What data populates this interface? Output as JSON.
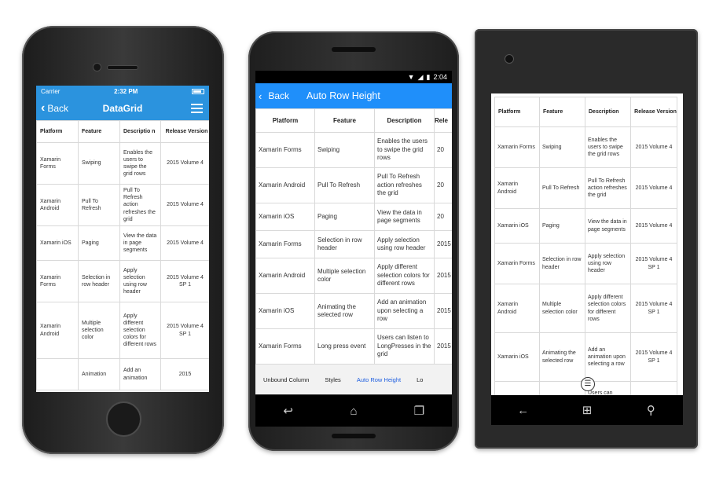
{
  "ios": {
    "status": {
      "carrier": "Carrier",
      "time": "2:32 PM"
    },
    "nav": {
      "back": "Back",
      "title": "DataGrid"
    },
    "columns": [
      "Platform",
      "Feature",
      "Descriptio n",
      "Release Version"
    ],
    "rows": [
      [
        "Xamarin Forms",
        "Swiping",
        "Enables the users to swipe the grid rows",
        "2015 Volume 4"
      ],
      [
        "Xamarin Android",
        "Pull To Refresh",
        "Pull To Refresh action refreshes the grid",
        "2015 Volume 4"
      ],
      [
        "Xamarin iOS",
        "Paging",
        "View the data in page segments",
        "2015 Volume 4"
      ],
      [
        "Xamarin Forms",
        "Selection in row header",
        "Apply selection using row header",
        "2015 Volume 4 SP 1"
      ],
      [
        "Xamarin Android",
        "Multiple selection color",
        "Apply different selection colors for different rows",
        "2015 Volume 4 SP 1"
      ],
      [
        "",
        "Animation",
        "Add an animation",
        "2015"
      ]
    ]
  },
  "android": {
    "status": {
      "time": "2:04"
    },
    "toolbar": {
      "back": "Back",
      "title": "Auto Row Height"
    },
    "columns": [
      "Platform",
      "Feature",
      "Description",
      "Rele"
    ],
    "rows": [
      [
        "Xamarin Forms",
        "Swiping",
        "Enables the users to swipe the grid rows",
        "20"
      ],
      [
        "Xamarin Android",
        "Pull To Refresh",
        "Pull To Refresh action refreshes the grid",
        "20"
      ],
      [
        "Xamarin iOS",
        "Paging",
        "View the data in page segments",
        "20"
      ],
      [
        "Xamarin Forms",
        "Selection in row header",
        "Apply selection using row header",
        "2015"
      ],
      [
        "Xamarin Android",
        "Multiple selection color",
        "Apply different selection colors for different rows",
        "2015"
      ],
      [
        "Xamarin iOS",
        "Animating the selected row",
        "Add an animation upon selecting a row",
        "2015"
      ],
      [
        "Xamarin Forms",
        "Long press event",
        "Users can listen to LongPresses in the grid",
        "2015"
      ]
    ],
    "tabs": [
      "Unbound Column",
      "Styles",
      "Auto Row Height",
      "Lo"
    ],
    "active_tab": 2
  },
  "windows": {
    "columns": [
      "Platform",
      "Feature",
      "Description",
      "Release Version"
    ],
    "rows": [
      [
        "Xamarin Forms",
        "Swiping",
        "Enables the users to swipe the grid rows",
        "2015 Volume 4"
      ],
      [
        "Xamarin Android",
        "Pull To Refresh",
        "Pull To Refresh action refreshes the grid",
        "2015 Volume 4"
      ],
      [
        "Xamarin iOS",
        "Paging",
        "View the data in page segments",
        "2015 Volume 4"
      ],
      [
        "Xamarin Forms",
        "Selection in row header",
        "Apply selection using row header",
        "2015 Volume 4 SP 1"
      ],
      [
        "Xamarin Android",
        "Multiple selection color",
        "Apply different selection colors for different rows",
        "2015 Volume 4 SP 1"
      ],
      [
        "Xamarin iOS",
        "Animating the selected row",
        "Add an animation upon selecting a row",
        "2015 Volume 4 SP 1"
      ],
      [
        "",
        "",
        "Users can",
        ""
      ]
    ]
  },
  "colors": {
    "ios_header": "#2b93de",
    "android_toolbar": "#1f8ffa",
    "active_tab": "#1f5fe0"
  }
}
